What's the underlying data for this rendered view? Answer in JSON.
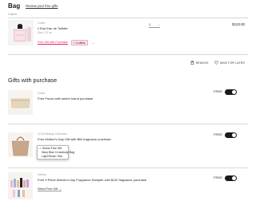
{
  "header": {
    "title": "Bag",
    "review_link": "Review your free gifts",
    "item_count": "3 items"
  },
  "product": {
    "brand": "Chloé",
    "name": "L'Eau Eau de Toilette",
    "size": "Size: 3.3 oz",
    "promo_text": "Free Gift with Purchase",
    "promo_badge": "+ 3 offers",
    "quantity": "1",
    "price": "$133.00",
    "remove_label": "REMOVE",
    "save_label": "SAVE FOR LATER"
  },
  "gifts_section": {
    "title": "Gifts with purchase",
    "items": [
      {
        "brand": "Chloé",
        "description": "Free Pouch with select brand purchase",
        "status": "FREE",
        "toggle_on": true
      },
      {
        "brand": "ULTA Beauty Collection",
        "description": "Free Mother's Day Gift with $60 fragrance purchase",
        "status": "FREE",
        "toggle_on": true,
        "select_options": [
          "Select Free Gift",
          "Navy Blue Crossbody Bag",
          "Light Brown Tote"
        ],
        "selected_option": "Select Free Gift"
      },
      {
        "brand": "Variety",
        "description": "Free 9 Piece Mother's Day Fragrance Sampler with $110 fragrance purchase",
        "status": "FREE",
        "toggle_on": true,
        "select_value": "Select Free Gift"
      }
    ]
  },
  "colors": {
    "accent_pink": "#e4285a",
    "toggle": "#1a1a1a",
    "divider": "#d8d8d8"
  }
}
